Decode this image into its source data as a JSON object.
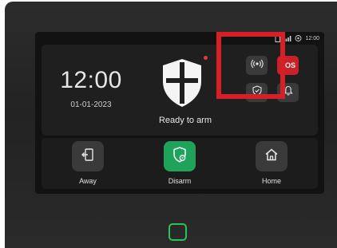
{
  "status_bar": {
    "time": "12:00",
    "icons": [
      "sim-icon",
      "signal-icon",
      "wifi-icon"
    ]
  },
  "panel": {
    "time": "12:00",
    "date": "01-01-2023",
    "status": "Ready to arm",
    "status_icon": "shield-cross-icon"
  },
  "quick_actions": [
    {
      "name": "wireless-broadcast-icon",
      "label": ""
    },
    {
      "name": "sos",
      "label": "SOS"
    },
    {
      "name": "shield-check-icon",
      "label": ""
    },
    {
      "name": "bell-icon",
      "label": ""
    }
  ],
  "actions": [
    {
      "label": "Away",
      "icon": "exit-door-icon"
    },
    {
      "label": "Disarm",
      "icon": "shield-disarm-icon",
      "active": true
    },
    {
      "label": "Home",
      "icon": "house-icon"
    }
  ],
  "colors": {
    "accent_green": "#1fa25a",
    "sos_red": "#c8212a",
    "highlight_red": "#d61f26",
    "home_key_green": "#29c454"
  }
}
